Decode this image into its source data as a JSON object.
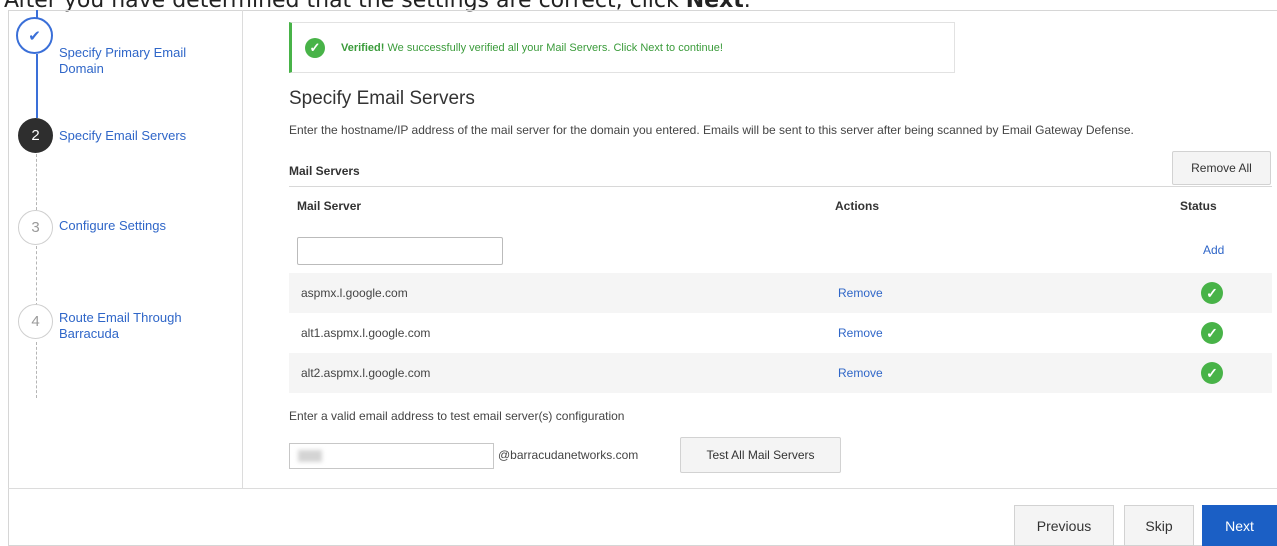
{
  "doc_text": {
    "prefix": "After you have determined that the settings are correct, click ",
    "bold": "Next",
    "suffix": "."
  },
  "wizard_steps": [
    {
      "number": "✔",
      "label": "Specify Primary Email Domain",
      "state": "done"
    },
    {
      "number": "2",
      "label": "Specify Email Servers",
      "state": "active"
    },
    {
      "number": "3",
      "label": "Configure Settings",
      "state": "pending"
    },
    {
      "number": "4",
      "label": "Route Email Through Barracuda",
      "state": "pending"
    }
  ],
  "banner": {
    "icon": "check-circle-icon",
    "bold": "Verified!",
    "text": " We successfully verified all your Mail Servers. Click Next to continue!",
    "color": "#48b348"
  },
  "section": {
    "title": "Specify Email Servers",
    "description": "Enter the hostname/IP address of the mail server for the domain you entered. Emails will be sent to this server after being scanned by Email Gateway Defense."
  },
  "mail_servers": {
    "title": "Mail Servers",
    "remove_all_label": "Remove All",
    "columns": {
      "server": "Mail Server",
      "actions": "Actions",
      "status": "Status"
    },
    "new_server_value": "",
    "add_label": "Add",
    "rows": [
      {
        "server": "aspmx.l.google.com",
        "action": "Remove",
        "status": "verified"
      },
      {
        "server": "alt1.aspmx.l.google.com",
        "action": "Remove",
        "status": "verified"
      },
      {
        "server": "alt2.aspmx.l.google.com",
        "action": "Remove",
        "status": "verified"
      }
    ]
  },
  "test": {
    "label": "Enter a valid email address to test email server(s) configuration",
    "domain_suffix": "@barracudanetworks.com",
    "button_label": "Test All Mail Servers"
  },
  "footer": {
    "previous_label": "Previous",
    "skip_label": "Skip",
    "next_label": "Next",
    "accent_color": "#1b5fc5"
  }
}
